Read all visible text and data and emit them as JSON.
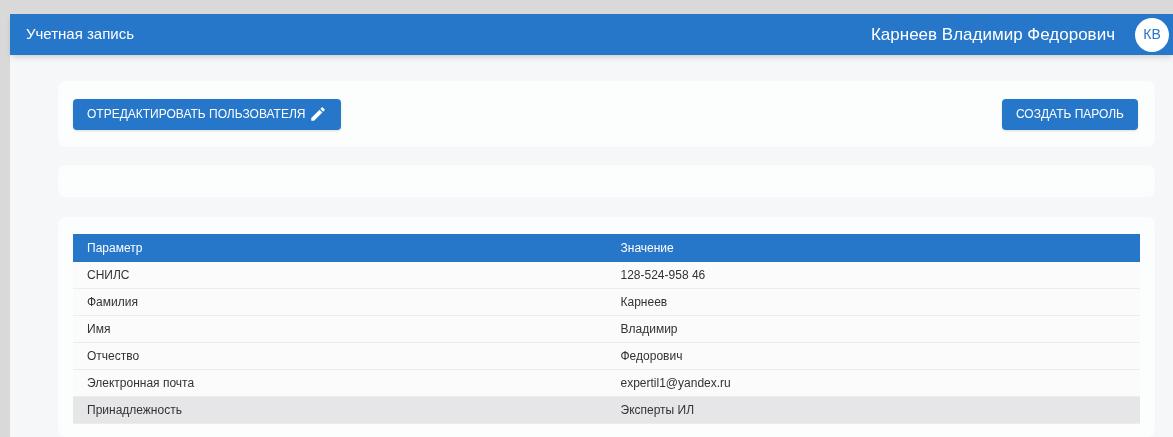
{
  "app_bar": {
    "title": "Учетная запись",
    "user_name": "Карнеев Владимир Федорович",
    "avatar_initials": "КВ"
  },
  "actions": {
    "edit_button": "ОТРЕДАКТИРОВАТЬ ПОЛЬЗОВАТЕЛЯ",
    "create_password_button": "СОЗДАТЬ ПАРОЛЬ"
  },
  "table": {
    "columns": [
      "Параметр",
      "Значение"
    ],
    "rows": [
      {
        "cells": [
          "СНИЛС",
          "128-524-958 46"
        ],
        "selected": false
      },
      {
        "cells": [
          "Фамилия",
          "Карнеев"
        ],
        "selected": false
      },
      {
        "cells": [
          "Имя",
          "Владимир"
        ],
        "selected": false
      },
      {
        "cells": [
          "Отчество",
          "Федорович"
        ],
        "selected": false
      },
      {
        "cells": [
          "Электронная почта",
          "expertil1@yandex.ru"
        ],
        "selected": false
      },
      {
        "cells": [
          "Принадлежность",
          "Эксперты ИЛ"
        ],
        "selected": true
      }
    ]
  }
}
